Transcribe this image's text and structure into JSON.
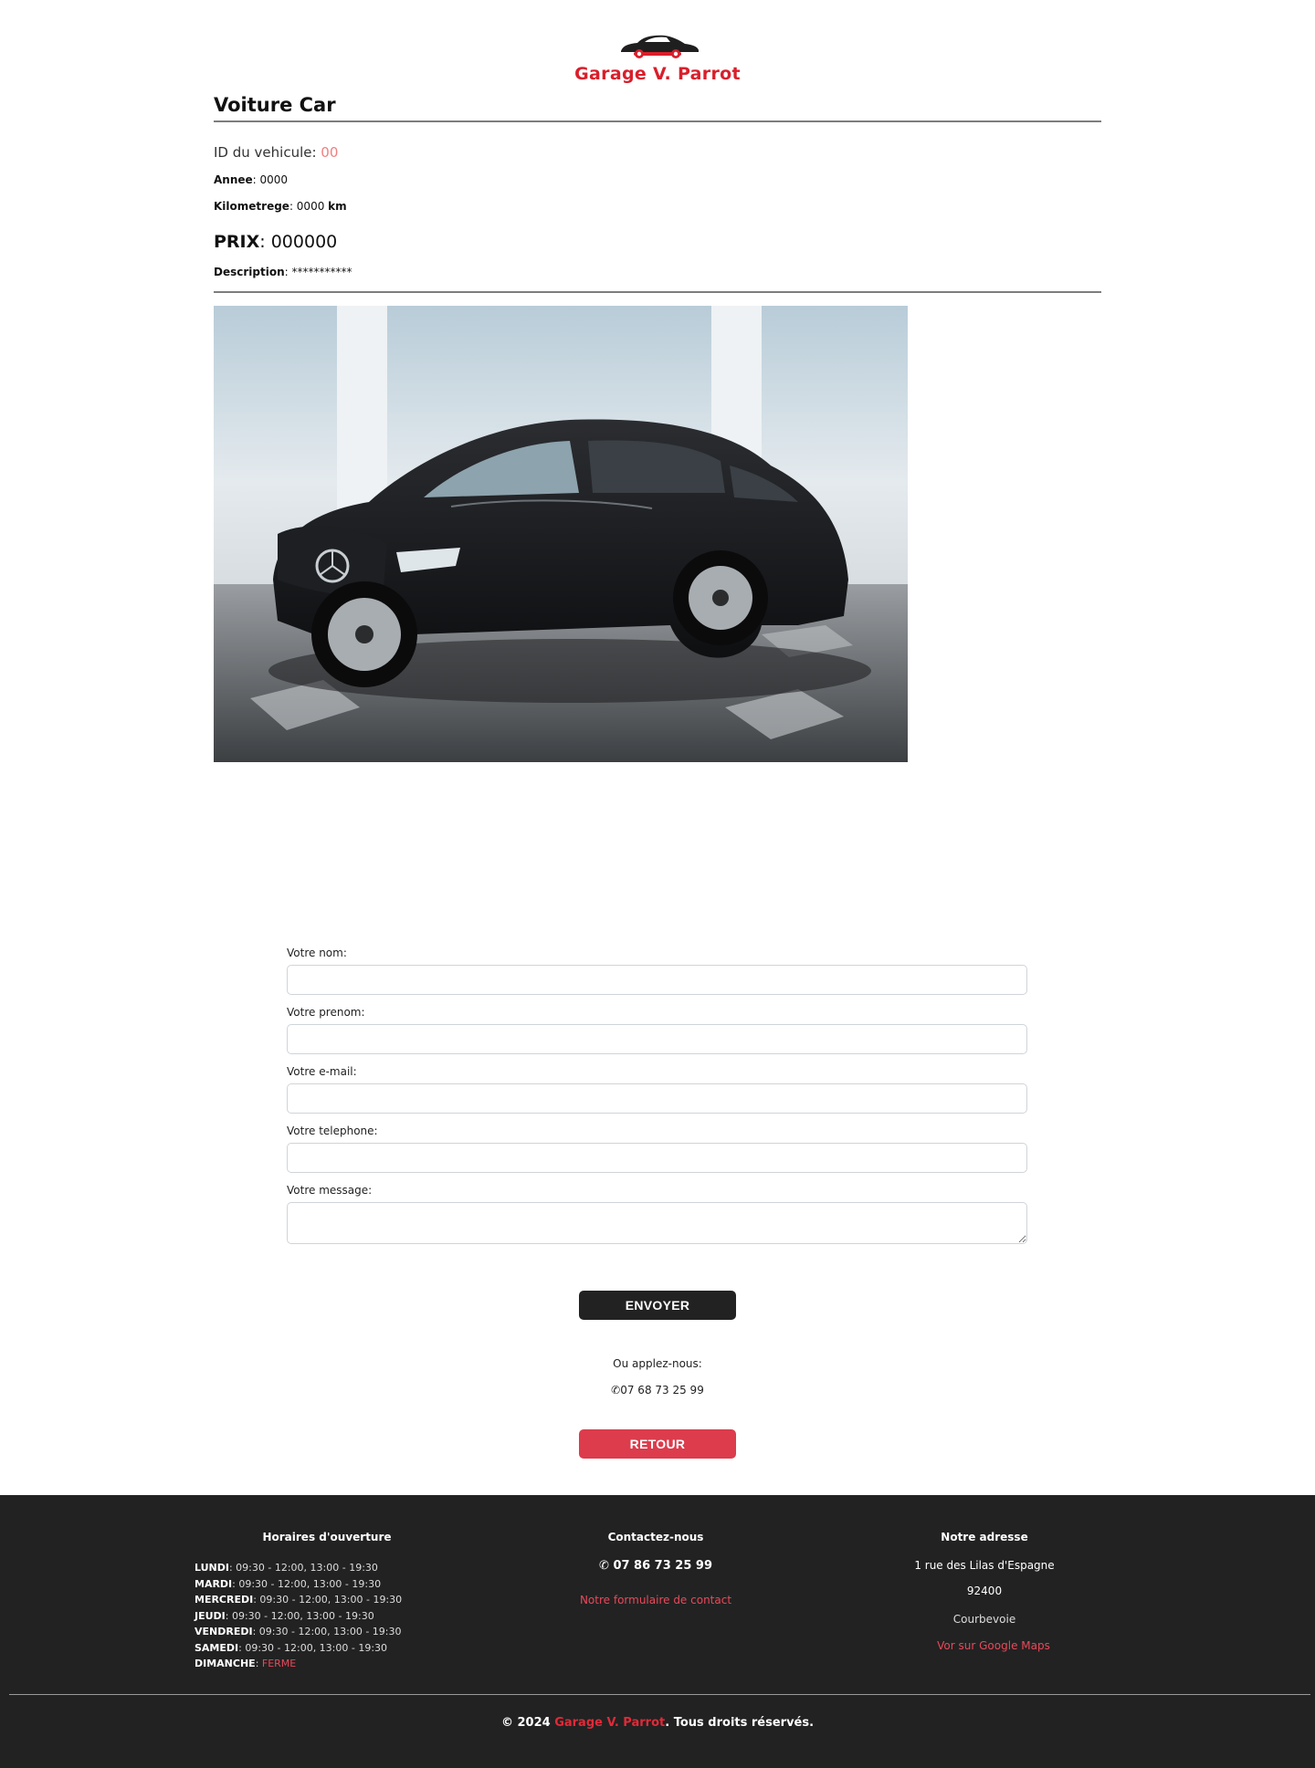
{
  "header": {
    "brand": "Garage V. Parrot"
  },
  "vehicle": {
    "title": "Voiture Car",
    "id_label": "ID du vehicule: ",
    "id_value": "00",
    "annee_label": "Annee",
    "annee_value": ": 0000",
    "km_label": "Kilometrege",
    "km_value": ": 0000 ",
    "km_unit": "km",
    "prix_label": "PRIX",
    "prix_value": ": 000000",
    "description_label": "Description",
    "description_value": ": ***********"
  },
  "form": {
    "nom_label": "Votre nom:",
    "prenom_label": "Votre prenom:",
    "email_label": "Votre e-mail:",
    "telephone_label": "Votre telephone:",
    "message_label": "Votre message:",
    "send_label": "ENVOYER"
  },
  "call": {
    "label": "Ou applez-nous:",
    "phone": "07 68 73 25 99"
  },
  "back_label": "RETOUR",
  "footer": {
    "hours_title": "Horaires d'ouverture",
    "hours": [
      {
        "day": "LUNDI",
        "time": ": 09:30 - 12:00, 13:00 - 19:30"
      },
      {
        "day": "MARDI",
        "time": ": 09:30 - 12:00, 13:00 - 19:30"
      },
      {
        "day": "MERCREDI",
        "time": ": 09:30 - 12:00, 13:00 - 19:30"
      },
      {
        "day": "JEUDI",
        "time": ": 09:30 - 12:00, 13:00 - 19:30"
      },
      {
        "day": "VENDREDI",
        "time": ": 09:30 - 12:00, 13:00 - 19:30"
      },
      {
        "day": "SAMEDI",
        "time": ": 09:30 - 12:00, 13:00 - 19:30"
      }
    ],
    "sunday_day": "DIMANCHE",
    "sunday_sep": ": ",
    "sunday_status": "FERME",
    "contact_title": "Contactez-nous",
    "contact_phone": "07 86 73 25 99",
    "contact_form_link": "Notre formulaire de contact",
    "address_title": "Notre adresse",
    "address_street": "1 rue des Lilas d'Espagne",
    "address_zip": "92400",
    "address_city": "Courbevoie",
    "maps_link": "Vor sur Google Maps",
    "copyright_prefix": "© 2024 ",
    "copyright_brand": "Garage V. Parrot",
    "copyright_suffix": ". Tous droits réservés."
  },
  "colors": {
    "accent_red": "#dc3c4c",
    "brand_red": "#d91f2b",
    "dark": "#222222"
  }
}
